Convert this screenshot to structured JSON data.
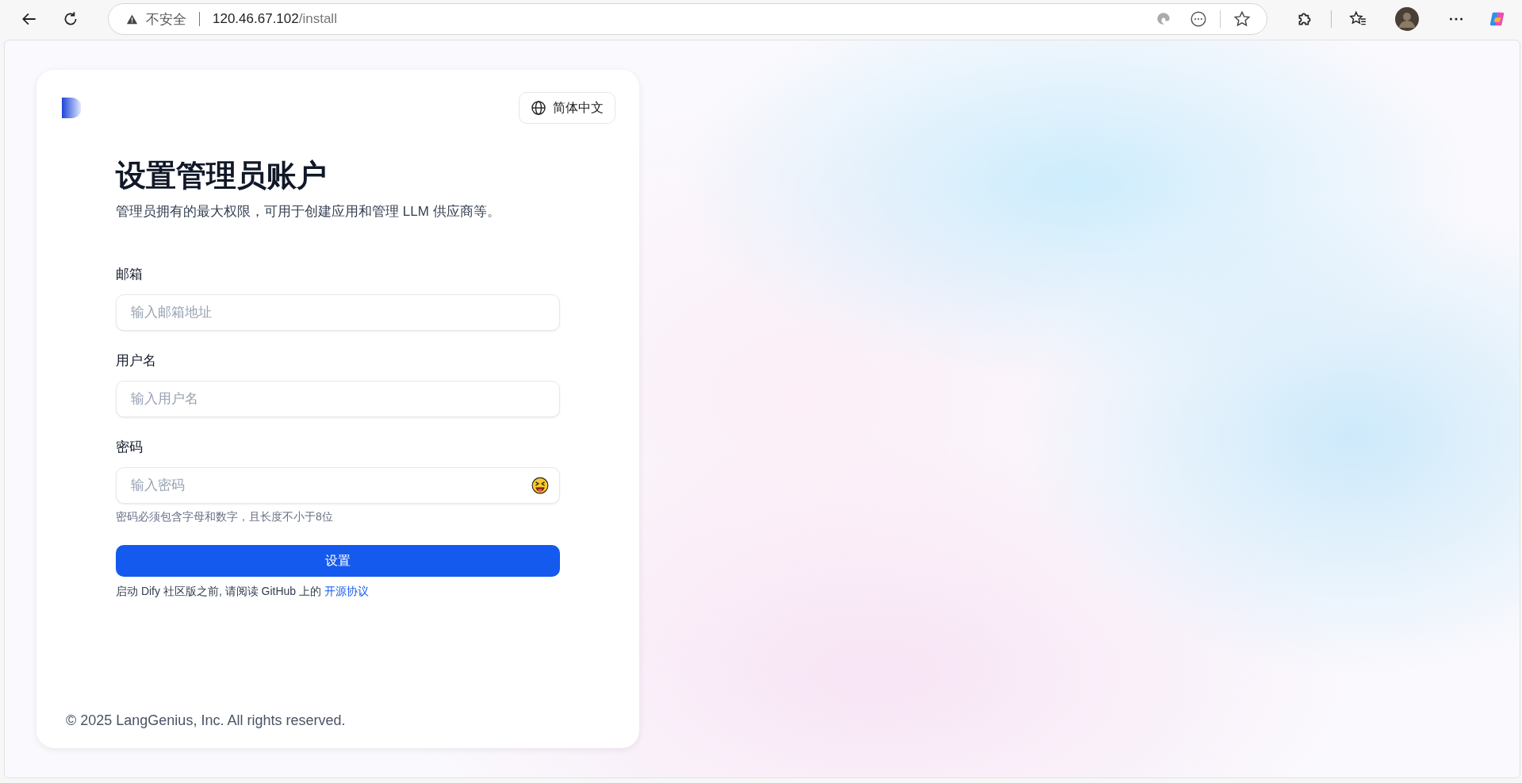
{
  "browser": {
    "security_label": "不安全",
    "url_host": "120.46.67.102",
    "url_path": "/install"
  },
  "card": {
    "language": "简体中文",
    "title": "设置管理员账户",
    "subtitle": "管理员拥有的最大权限，可用于创建应用和管理 LLM 供应商等。",
    "fields": [
      {
        "kind": "text",
        "label": "邮箱",
        "placeholder": "输入邮箱地址"
      },
      {
        "kind": "text",
        "label": "用户名",
        "placeholder": "输入用户名"
      },
      {
        "kind": "password",
        "label": "密码",
        "placeholder": "输入密码",
        "hint": "密码必须包含字母和数字，且长度不小于8位"
      }
    ],
    "submit": "设置",
    "notice": {
      "text": "启动 Dify 社区版之前, 请阅读 GitHub 上的",
      "link": "开源协议"
    },
    "footer": "© 2025 LangGenius, Inc. All rights reserved."
  }
}
